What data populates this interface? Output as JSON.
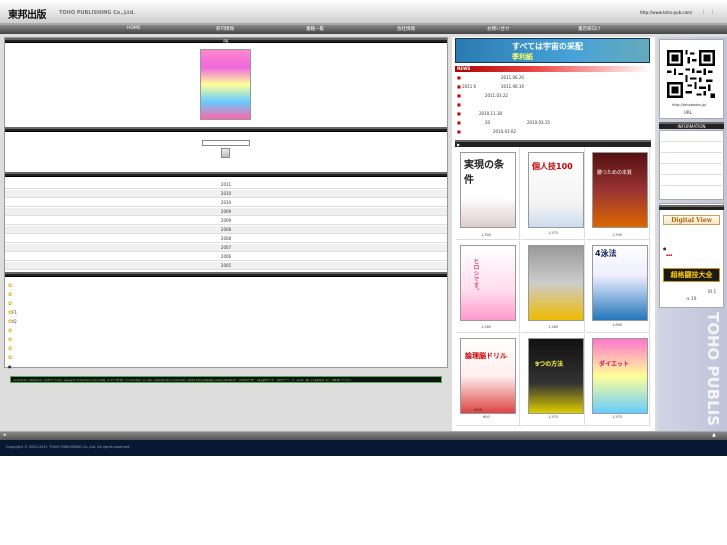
{
  "header": {
    "logo_jp": "東邦出版",
    "logo_en": "TOHO PUBLISHING Co.,Ltd.",
    "url": "http://www.toho-pub.com/"
  },
  "nav": {
    "items": [
      "HOME",
      "新刊情報",
      "書籍一覧",
      "会社情報",
      "お問い合せ",
      "書店様向け"
    ]
  },
  "left": {
    "pr_label": "PR",
    "years": [
      "2011",
      "2010",
      "2010",
      "2009",
      "2009",
      "2008",
      "2008",
      "2007",
      "2006",
      "2005"
    ],
    "links": [
      "",
      "",
      "",
      "F1",
      "IQ",
      "",
      "",
      "",
      ""
    ],
    "counter": "<counter-data><a href=\"rcan-npaeys\">Counter</a><img src=\"http://counter.w-cdx.com/ex/acc/counter.php?id=xyz&amp;nbsp;mode=1\" width=\"8\" height=\"1\" alt=\"*\" /> sunt be created in r2010 f:r\\n"
  },
  "mid": {
    "banner_text": "すべては宇宙の采配",
    "banner_text2": "季利紙",
    "news_label": "NEWS",
    "news": [
      {
        "a": "",
        "b": "2011.06.20"
      },
      {
        "a": "2011 6",
        "b": "2011.06.19"
      },
      {
        "a": "",
        "b": "2011.03.22"
      },
      {
        "a": "",
        "b": ""
      },
      {
        "a": "",
        "b": "2010.11.18"
      },
      {
        "a": "20",
        "b": "2010.03.15"
      },
      {
        "a": "",
        "b": "2010.03.02"
      }
    ],
    "books_label": "▶",
    "books": [
      {
        "price": "1,300",
        "title": "実現の条件",
        "colors": [
          "#fff",
          "#fff",
          "#eee"
        ]
      },
      {
        "price": "1,575",
        "title": "個人技100",
        "colors": [
          "#fff",
          "#fff",
          "#eee"
        ]
      },
      {
        "price": "1,500",
        "title": "勝つための本質",
        "colors": [
          "#611",
          "#a33",
          "#c60"
        ]
      },
      {
        "price": "1,260",
        "title": "ヒロシです。",
        "colors": [
          "#fdd",
          "#fbb",
          "#f99"
        ]
      },
      {
        "price": "1,260",
        "title": "",
        "colors": [
          "#aaa",
          "#ddd",
          "#ec0"
        ]
      },
      {
        "price": "1,890",
        "title": "4泳法",
        "colors": [
          "#fff",
          "#eef",
          "#37c"
        ]
      },
      {
        "price": "600",
        "title": "論理脳ドリル",
        "colors": [
          "#fff",
          "#fee",
          "#c33"
        ]
      },
      {
        "price": "1,575",
        "title": "9つの方法",
        "colors": [
          "#111",
          "#333",
          "#dd0"
        ]
      },
      {
        "price": "1,575",
        "title": "ダイエット",
        "colors": [
          "#f8c",
          "#ff9",
          "#6cf"
        ]
      }
    ],
    "new_label": "NEW"
  },
  "right": {
    "qr_url": "http://tohobooks.jp/",
    "qr_label": "URL",
    "info_label": "INFORMATION",
    "dv_logo": "Digital View",
    "rk_logo": "超格闘技大全",
    "side_note": "IO 1",
    "side_note2": "ル 10",
    "vertical_text": "TOHO PUBLIS"
  },
  "footer": {
    "copyright": "Copyright © 2003-2011 TOHO PUBLISHING Co.,Ltd. All rights reserved."
  },
  "colors": {
    "nav_bg": "#555555",
    "footer_bg": "#081830",
    "news_red": "#cc0000"
  }
}
